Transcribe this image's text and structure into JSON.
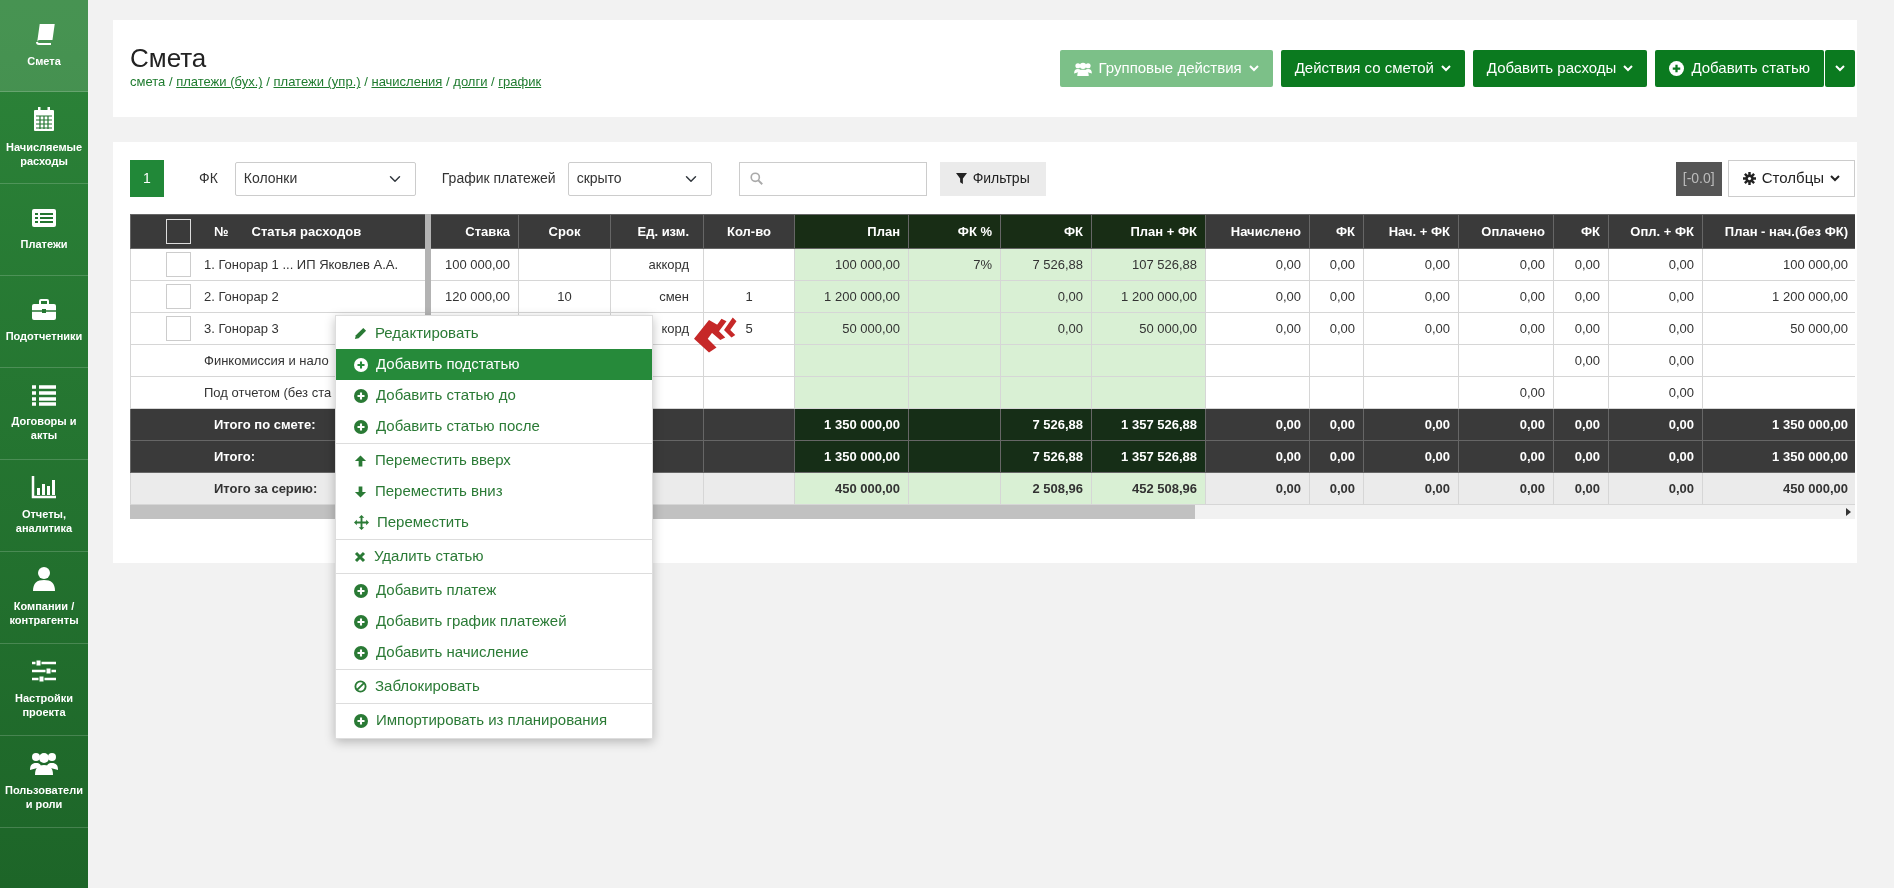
{
  "sidebar": {
    "items": [
      {
        "label": "Смета",
        "selected": true
      },
      {
        "label": "Начисляемые расходы",
        "selected": false
      },
      {
        "label": "Платежи",
        "selected": false
      },
      {
        "label": "Подотчетники",
        "selected": false
      },
      {
        "label": "Договоры и акты",
        "selected": false
      },
      {
        "label": "Отчеты, аналитика",
        "selected": false
      },
      {
        "label": "Компании / контрагенты",
        "selected": false
      },
      {
        "label": "Настройки проекта",
        "selected": false
      },
      {
        "label": "Пользователи и роли",
        "selected": false
      }
    ]
  },
  "header": {
    "title": "Смета",
    "breadcrumbs": [
      {
        "label": "смета",
        "link": false
      },
      {
        "separator": "/",
        "label": "платежи (бух.)",
        "link": true
      },
      {
        "separator": "/",
        "label": "платежи (упр.)",
        "link": true
      },
      {
        "separator": "/",
        "label": "начисления",
        "link": true
      },
      {
        "separator": "/",
        "label": "долги",
        "link": true
      },
      {
        "separator": "/",
        "label": "график",
        "link": true
      }
    ],
    "buttons": [
      {
        "kind": "group",
        "label": "Групповые действия",
        "disabled": true,
        "caret": true
      },
      {
        "kind": "menu",
        "label": "Действия со сметой",
        "disabled": false,
        "caret": true
      },
      {
        "kind": "menu",
        "label": "Добавить расходы",
        "disabled": false,
        "caret": true
      },
      {
        "kind": "add",
        "label": "Добавить статью",
        "disabled": false,
        "caret": false,
        "split": true
      }
    ]
  },
  "toolbar": {
    "badge": "1",
    "fk_label": "ФК",
    "fk_select": "Колонки",
    "schedule_label": "График платежей",
    "schedule_select": "скрыто",
    "filter_button": "Фильтры",
    "version": "[-0.0]",
    "columns_button": "Столбцы"
  },
  "table": {
    "select_all_checked": false,
    "number_label": "№",
    "name_label": "Статья расходов",
    "columns": [
      {
        "label": "Ставка",
        "highlighted": false
      },
      {
        "label": "Срок",
        "highlighted": false
      },
      {
        "label": "Ед. изм.",
        "highlighted": false
      },
      {
        "label": "Кол-во",
        "highlighted": false
      },
      {
        "label": "План",
        "highlighted": true
      },
      {
        "label": "ФК %",
        "highlighted": true
      },
      {
        "label": "ФК",
        "highlighted": true
      },
      {
        "label": "План + ФК",
        "highlighted": true
      },
      {
        "label": "Начислено",
        "highlighted": false
      },
      {
        "label": "ФК",
        "highlighted": false
      },
      {
        "label": "Нач. + ФК",
        "highlighted": false
      },
      {
        "label": "Оплачено",
        "highlighted": false
      },
      {
        "label": "ФК",
        "highlighted": false
      },
      {
        "label": "Опл. + ФК",
        "highlighted": false
      },
      {
        "label": "План - нач.(без ФК)",
        "highlighted": false
      }
    ],
    "rows": [
      {
        "kind": "item",
        "checked": false,
        "label": "1. Гонорар 1 ... ИП Яковлев А.А.",
        "cells": [
          "100 000,00",
          null,
          "аккорд",
          null,
          "100 000,00",
          "7%",
          "7 526,88",
          "107 526,88",
          "0,00",
          "0,00",
          "0,00",
          "0,00",
          "0,00",
          "0,00",
          "100 000,00"
        ]
      },
      {
        "kind": "item",
        "checked": false,
        "label": "2. Гонорар 2",
        "cells": [
          "120 000,00",
          "10",
          "смен",
          "1",
          "1 200 000,00",
          null,
          "0,00",
          "1 200 000,00",
          "0,00",
          "0,00",
          "0,00",
          "0,00",
          "0,00",
          "0,00",
          "1 200 000,00"
        ]
      },
      {
        "kind": "item",
        "checked": false,
        "label": "3. Гонорар 3",
        "cells": [
          null,
          null,
          "корд",
          "5",
          "50 000,00",
          null,
          "0,00",
          "50 000,00",
          "0,00",
          "0,00",
          "0,00",
          "0,00",
          "0,00",
          "0,00",
          "50 000,00"
        ]
      },
      {
        "kind": "sub",
        "label": "Финкомиссия и нало",
        "cells": [
          null,
          null,
          null,
          null,
          null,
          null,
          null,
          null,
          null,
          null,
          null,
          null,
          "0,00",
          "0,00",
          null
        ]
      },
      {
        "kind": "sub",
        "label": "Под отчетом (без ста",
        "cells": [
          null,
          null,
          null,
          null,
          null,
          null,
          null,
          null,
          null,
          null,
          null,
          "0,00",
          null,
          "0,00",
          null
        ]
      },
      {
        "kind": "total",
        "label": "Итого по смете:",
        "cells": [
          null,
          null,
          null,
          null,
          "1 350 000,00",
          null,
          "7 526,88",
          "1 357 526,88",
          "0,00",
          "0,00",
          "0,00",
          "0,00",
          "0,00",
          "0,00",
          "1 350 000,00"
        ]
      },
      {
        "kind": "total",
        "label": "Итого:",
        "cells": [
          null,
          null,
          null,
          null,
          "1 350 000,00",
          null,
          "7 526,88",
          "1 357 526,88",
          "0,00",
          "0,00",
          "0,00",
          "0,00",
          "0,00",
          "0,00",
          "1 350 000,00"
        ]
      },
      {
        "kind": "series",
        "label": "Итого за серию:",
        "cells": [
          null,
          null,
          null,
          null,
          "450 000,00",
          null,
          "2 508,96",
          "452 508,96",
          "0,00",
          "0,00",
          "0,00",
          "0,00",
          "0,00",
          "0,00",
          "450 000,00"
        ]
      }
    ]
  },
  "context_menu": {
    "groups": [
      [
        {
          "kind": "edit",
          "label": "Редактировать",
          "selected": false
        },
        {
          "kind": "add",
          "label": "Добавить подстатью",
          "selected": true
        },
        {
          "kind": "add",
          "label": "Добавить статью до",
          "selected": false
        },
        {
          "kind": "add",
          "label": "Добавить статью после",
          "selected": false
        }
      ],
      [
        {
          "kind": "up",
          "label": "Переместить вверх",
          "selected": false
        },
        {
          "kind": "down",
          "label": "Переместить вниз",
          "selected": false
        },
        {
          "kind": "move",
          "label": "Переместить",
          "selected": false
        }
      ],
      [
        {
          "kind": "delete",
          "label": "Удалить статью",
          "selected": false
        }
      ],
      [
        {
          "kind": "add",
          "label": "Добавить платеж",
          "selected": false
        },
        {
          "kind": "add",
          "label": "Добавить график платежей",
          "selected": false
        },
        {
          "kind": "add",
          "label": "Добавить начисление",
          "selected": false
        }
      ],
      [
        {
          "kind": "lock",
          "label": "Заблокировать",
          "selected": false
        }
      ],
      [
        {
          "kind": "add",
          "label": "Импортировать из планирования",
          "selected": false
        }
      ]
    ]
  }
}
